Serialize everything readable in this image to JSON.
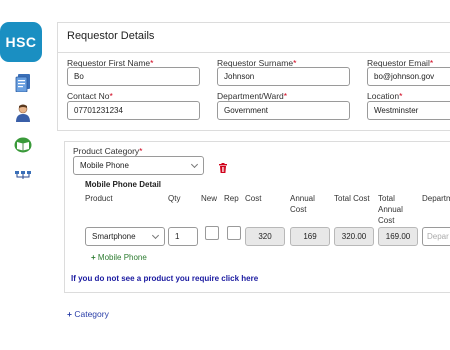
{
  "sidebar": {
    "logo": "HSC",
    "icons": [
      "document-icon",
      "user-icon",
      "book-icon",
      "network-icon"
    ]
  },
  "page": {
    "title": "Requestor Details"
  },
  "requestor": {
    "first_name_label": "Requestor First Name",
    "first_name_value": "Bo",
    "surname_label": "Requestor Surname",
    "surname_value": "Johnson",
    "email_label": "Requestor Email",
    "email_value": "bo@johnson.gov",
    "contact_label": "Contact No",
    "contact_value": "07701231234",
    "department_label": "Department/Ward",
    "department_value": "Government",
    "location_label": "Location",
    "location_value": "Westminster",
    "required_marker": "*"
  },
  "product": {
    "category_label": "Product Category",
    "category_value": "Mobile Phone",
    "detail_heading": "Mobile Phone Detail",
    "columns": {
      "product": "Product",
      "qty": "Qty",
      "new": "New",
      "rep": "Rep",
      "cost": "Cost",
      "annual_cost": "Annual Cost",
      "total_cost": "Total Cost",
      "total_annual_cost": "Total Annual Cost",
      "department": "Departm"
    },
    "row": {
      "product": "Smartphone",
      "qty": "1",
      "cost": "320",
      "annual_cost": "169",
      "total_cost": "320.00",
      "total_annual_cost": "169.00",
      "department_placeholder": "Depar"
    },
    "add_item_link": "Mobile Phone",
    "not_found_link": "If you do not see a product you require click here",
    "add_category_link": "Category"
  },
  "colors": {
    "brand": "#1a8fc2",
    "required": "#d0021b",
    "add_link": "#2e7d32",
    "help_link": "#1a1aa0",
    "delete": "#d0021b"
  }
}
